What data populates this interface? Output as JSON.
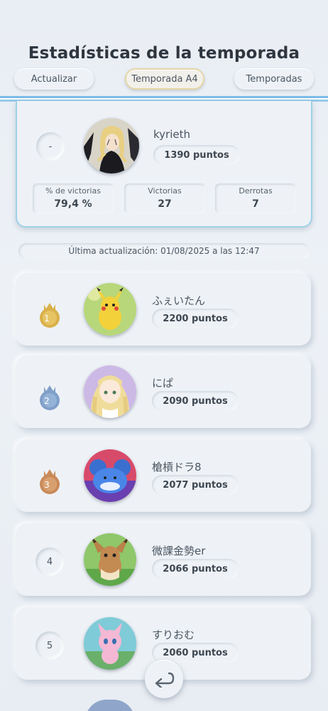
{
  "header": {
    "title": "Estadísticas de la temporada",
    "update_button": "Actualizar",
    "season_button": "Temporada A4",
    "seasons_button": "Temporadas"
  },
  "my_stats": {
    "rank": "-",
    "name": "kyrieth",
    "points": "1390 puntos",
    "win_rate_label": "% de victorias",
    "win_rate_value": "79,4 %",
    "wins_label": "Victorias",
    "wins_value": "27",
    "losses_label": "Derrotas",
    "losses_value": "7"
  },
  "last_update": "Última actualización: 01/08/2025 a las 12:47",
  "leaderboard": [
    {
      "rank": "1",
      "name": "ふぇいたん",
      "points": "2200 puntos",
      "medal": "gold-crown-medal"
    },
    {
      "rank": "2",
      "name": "にぱ",
      "points": "2090 puntos",
      "medal": "silver-crown-medal"
    },
    {
      "rank": "3",
      "name": "槍槓ドラ8",
      "points": "2077 puntos",
      "medal": "bronze-crown-medal"
    },
    {
      "rank": "4",
      "name": "微課金勢er",
      "points": "2066 puntos"
    },
    {
      "rank": "5",
      "name": "すりおむ",
      "points": "2060 puntos"
    }
  ],
  "icons": {
    "back": "return-arrow-icon"
  },
  "colors": {
    "accent_blue": "#6fb7e6",
    "gold": "#d9b04a",
    "silver": "#7f9fc8",
    "bronze": "#c98a5a"
  }
}
